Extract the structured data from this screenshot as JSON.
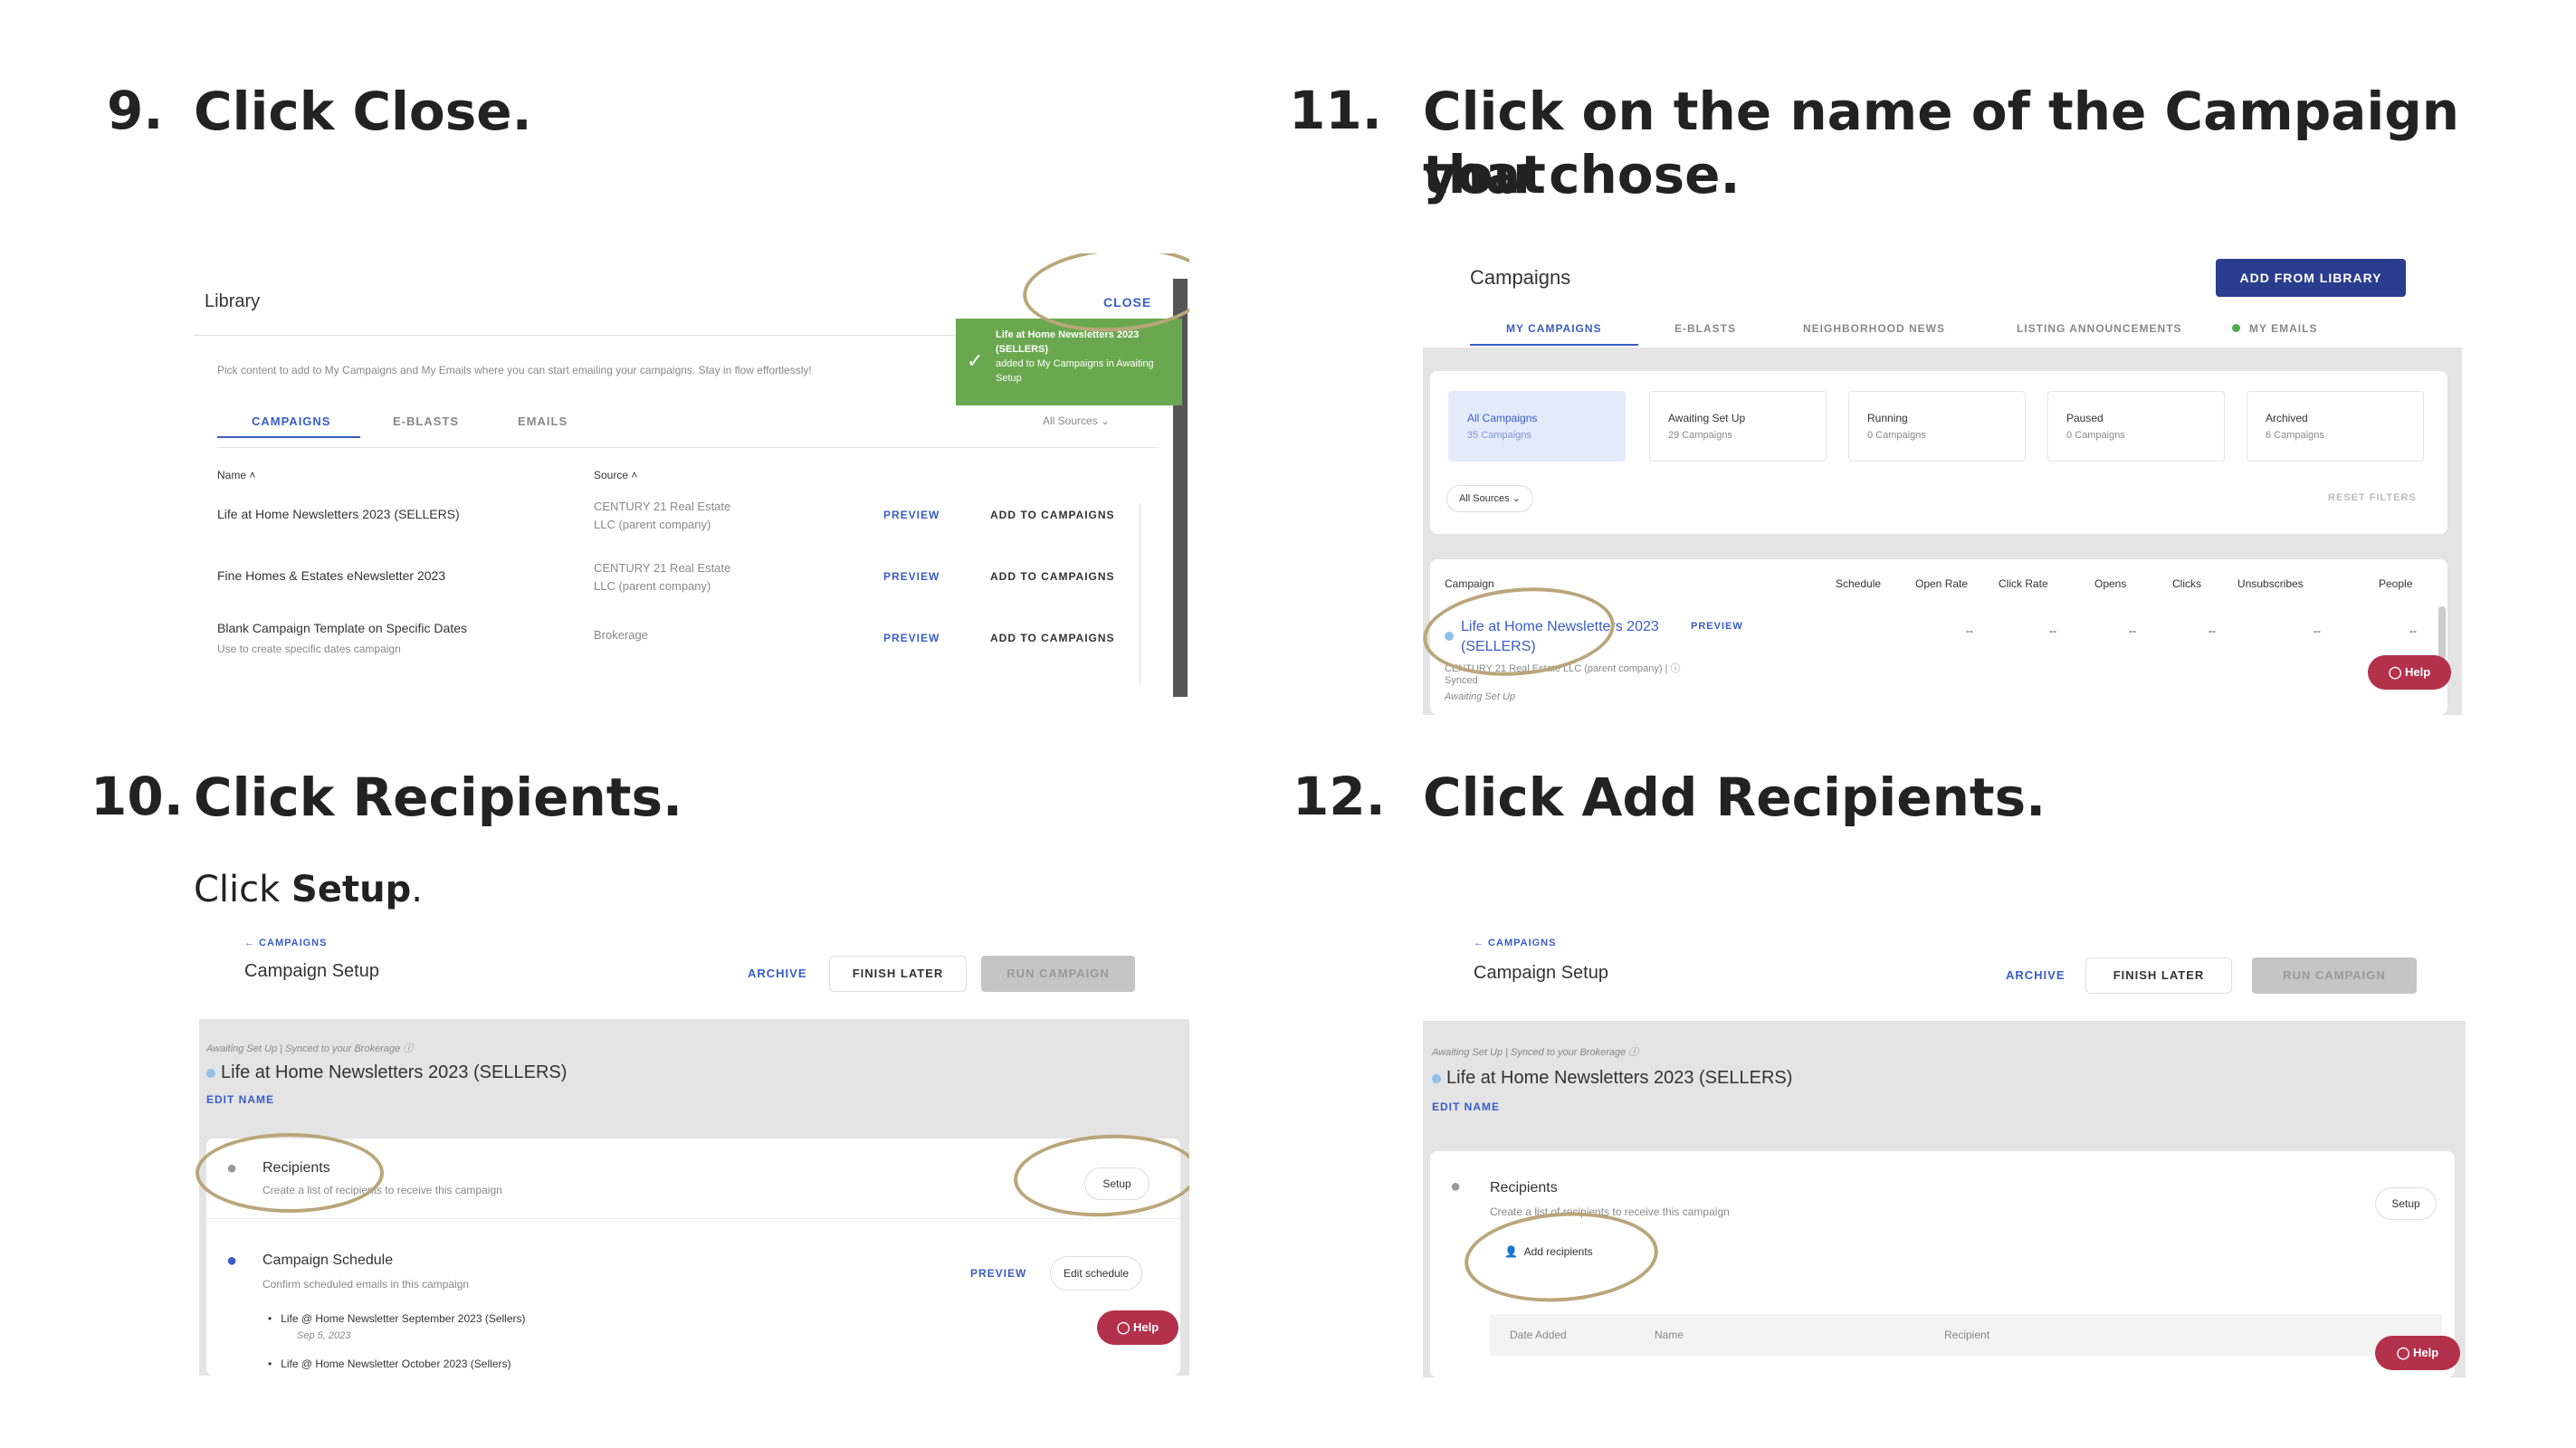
{
  "steps": {
    "s9": {
      "num": "9.",
      "title": "Click Close."
    },
    "s10": {
      "num": "10.",
      "title": "Click Recipients.",
      "sub_prefix": "Click ",
      "sub_bold": "Setup",
      "sub_suffix": "."
    },
    "s11": {
      "num": "11.",
      "title_line1": "Click on the name of the Campaign that",
      "title_line2": "you chose."
    },
    "s12": {
      "num": "12.",
      "title": "Click Add Recipients."
    }
  },
  "library": {
    "title": "Library",
    "close": "CLOSE",
    "toast": {
      "line1": "Life at Home Newsletters 2023",
      "line2": "(SELLERS)",
      "line3": "added to My Campaigns in Awaiting",
      "line4": "Setup"
    },
    "description": "Pick content to add to My Campaigns and My Emails where you can start emailing your campaigns. Stay in flow effortlessly!",
    "tabs": [
      "CAMPAIGNS",
      "E-BLASTS",
      "EMAILS"
    ],
    "filter": "All Sources",
    "col_name": "Name",
    "col_source": "Source",
    "rows": [
      {
        "name": "Life at Home Newsletters 2023 (SELLERS)",
        "sub": "",
        "source1": "CENTURY 21 Real Estate",
        "source2": "LLC (parent company)",
        "preview": "PREVIEW",
        "action": "ADD TO CAMPAIGNS"
      },
      {
        "name": "Fine Homes & Estates eNewsletter 2023",
        "sub": "",
        "source1": "CENTURY 21 Real Estate",
        "source2": "LLC (parent company)",
        "preview": "PREVIEW",
        "action": "ADD TO CAMPAIGNS"
      },
      {
        "name": "Blank Campaign Template on Specific Dates",
        "sub": "Use to create specific dates campaign",
        "source1": "Brokerage",
        "source2": "",
        "preview": "PREVIEW",
        "action": "ADD TO CAMPAIGNS"
      }
    ]
  },
  "campaigns": {
    "title": "Campaigns",
    "add_button": "ADD FROM LIBRARY",
    "tabs": [
      "MY CAMPAIGNS",
      "E-BLASTS",
      "NEIGHBORHOOD NEWS",
      "LISTING ANNOUNCEMENTS",
      "MY EMAILS"
    ],
    "stats": [
      {
        "label": "All Campaigns",
        "count": "35 Campaigns"
      },
      {
        "label": "Awaiting Set Up",
        "count": "29 Campaigns"
      },
      {
        "label": "Running",
        "count": "0 Campaigns"
      },
      {
        "label": "Paused",
        "count": "0 Campaigns"
      },
      {
        "label": "Archived",
        "count": "6 Campaigns"
      }
    ],
    "filter": "All Sources",
    "reset": "RESET FILTERS",
    "columns": [
      "Campaign",
      "Schedule",
      "Open Rate",
      "Click Rate",
      "Opens",
      "Clicks",
      "Unsubscribes",
      "People"
    ],
    "row": {
      "name_line1": "Life at Home Newsletters 2023",
      "name_line2": "(SELLERS)",
      "preview": "PREVIEW",
      "source": "CENTURY 21 Real Estate LLC (parent company)",
      "synced": "Synced",
      "status": "Awaiting Set Up",
      "dash": "--"
    },
    "help": "Help"
  },
  "setup": {
    "back": "← CAMPAIGNS",
    "title": "Campaign Setup",
    "archive": "ARCHIVE",
    "finish_later": "FINISH LATER",
    "run": "RUN CAMPAIGN",
    "status_line": "Awaiting Set Up  |  Synced to your Brokerage",
    "campaign_name": "Life at Home Newsletters 2023 (SELLERS)",
    "edit_name": "EDIT NAME",
    "recipients": "Recipients",
    "recipients_desc": "Create a list of recipients to receive this campaign",
    "setup_btn": "Setup",
    "schedule": "Campaign Schedule",
    "schedule_desc": "Confirm scheduled emails in this campaign",
    "preview": "PREVIEW",
    "edit_schedule": "Edit schedule",
    "email1": "Life @ Home Newsletter September 2023 (Sellers)",
    "email1_date": "Sep 5, 2023",
    "email2": "Life @ Home Newsletter October 2023 (Sellers)",
    "add_recipients": "Add recipients",
    "col_date": "Date Added",
    "col_name": "Name",
    "col_recipient": "Recipient",
    "help": "Help"
  },
  "colors": {
    "accent_blue": "#3a5cc8",
    "navy_button": "#2b3d8f",
    "toast_green": "#6aa84f",
    "help_red": "#b3314a",
    "ring_gold": "#b9a67a"
  }
}
